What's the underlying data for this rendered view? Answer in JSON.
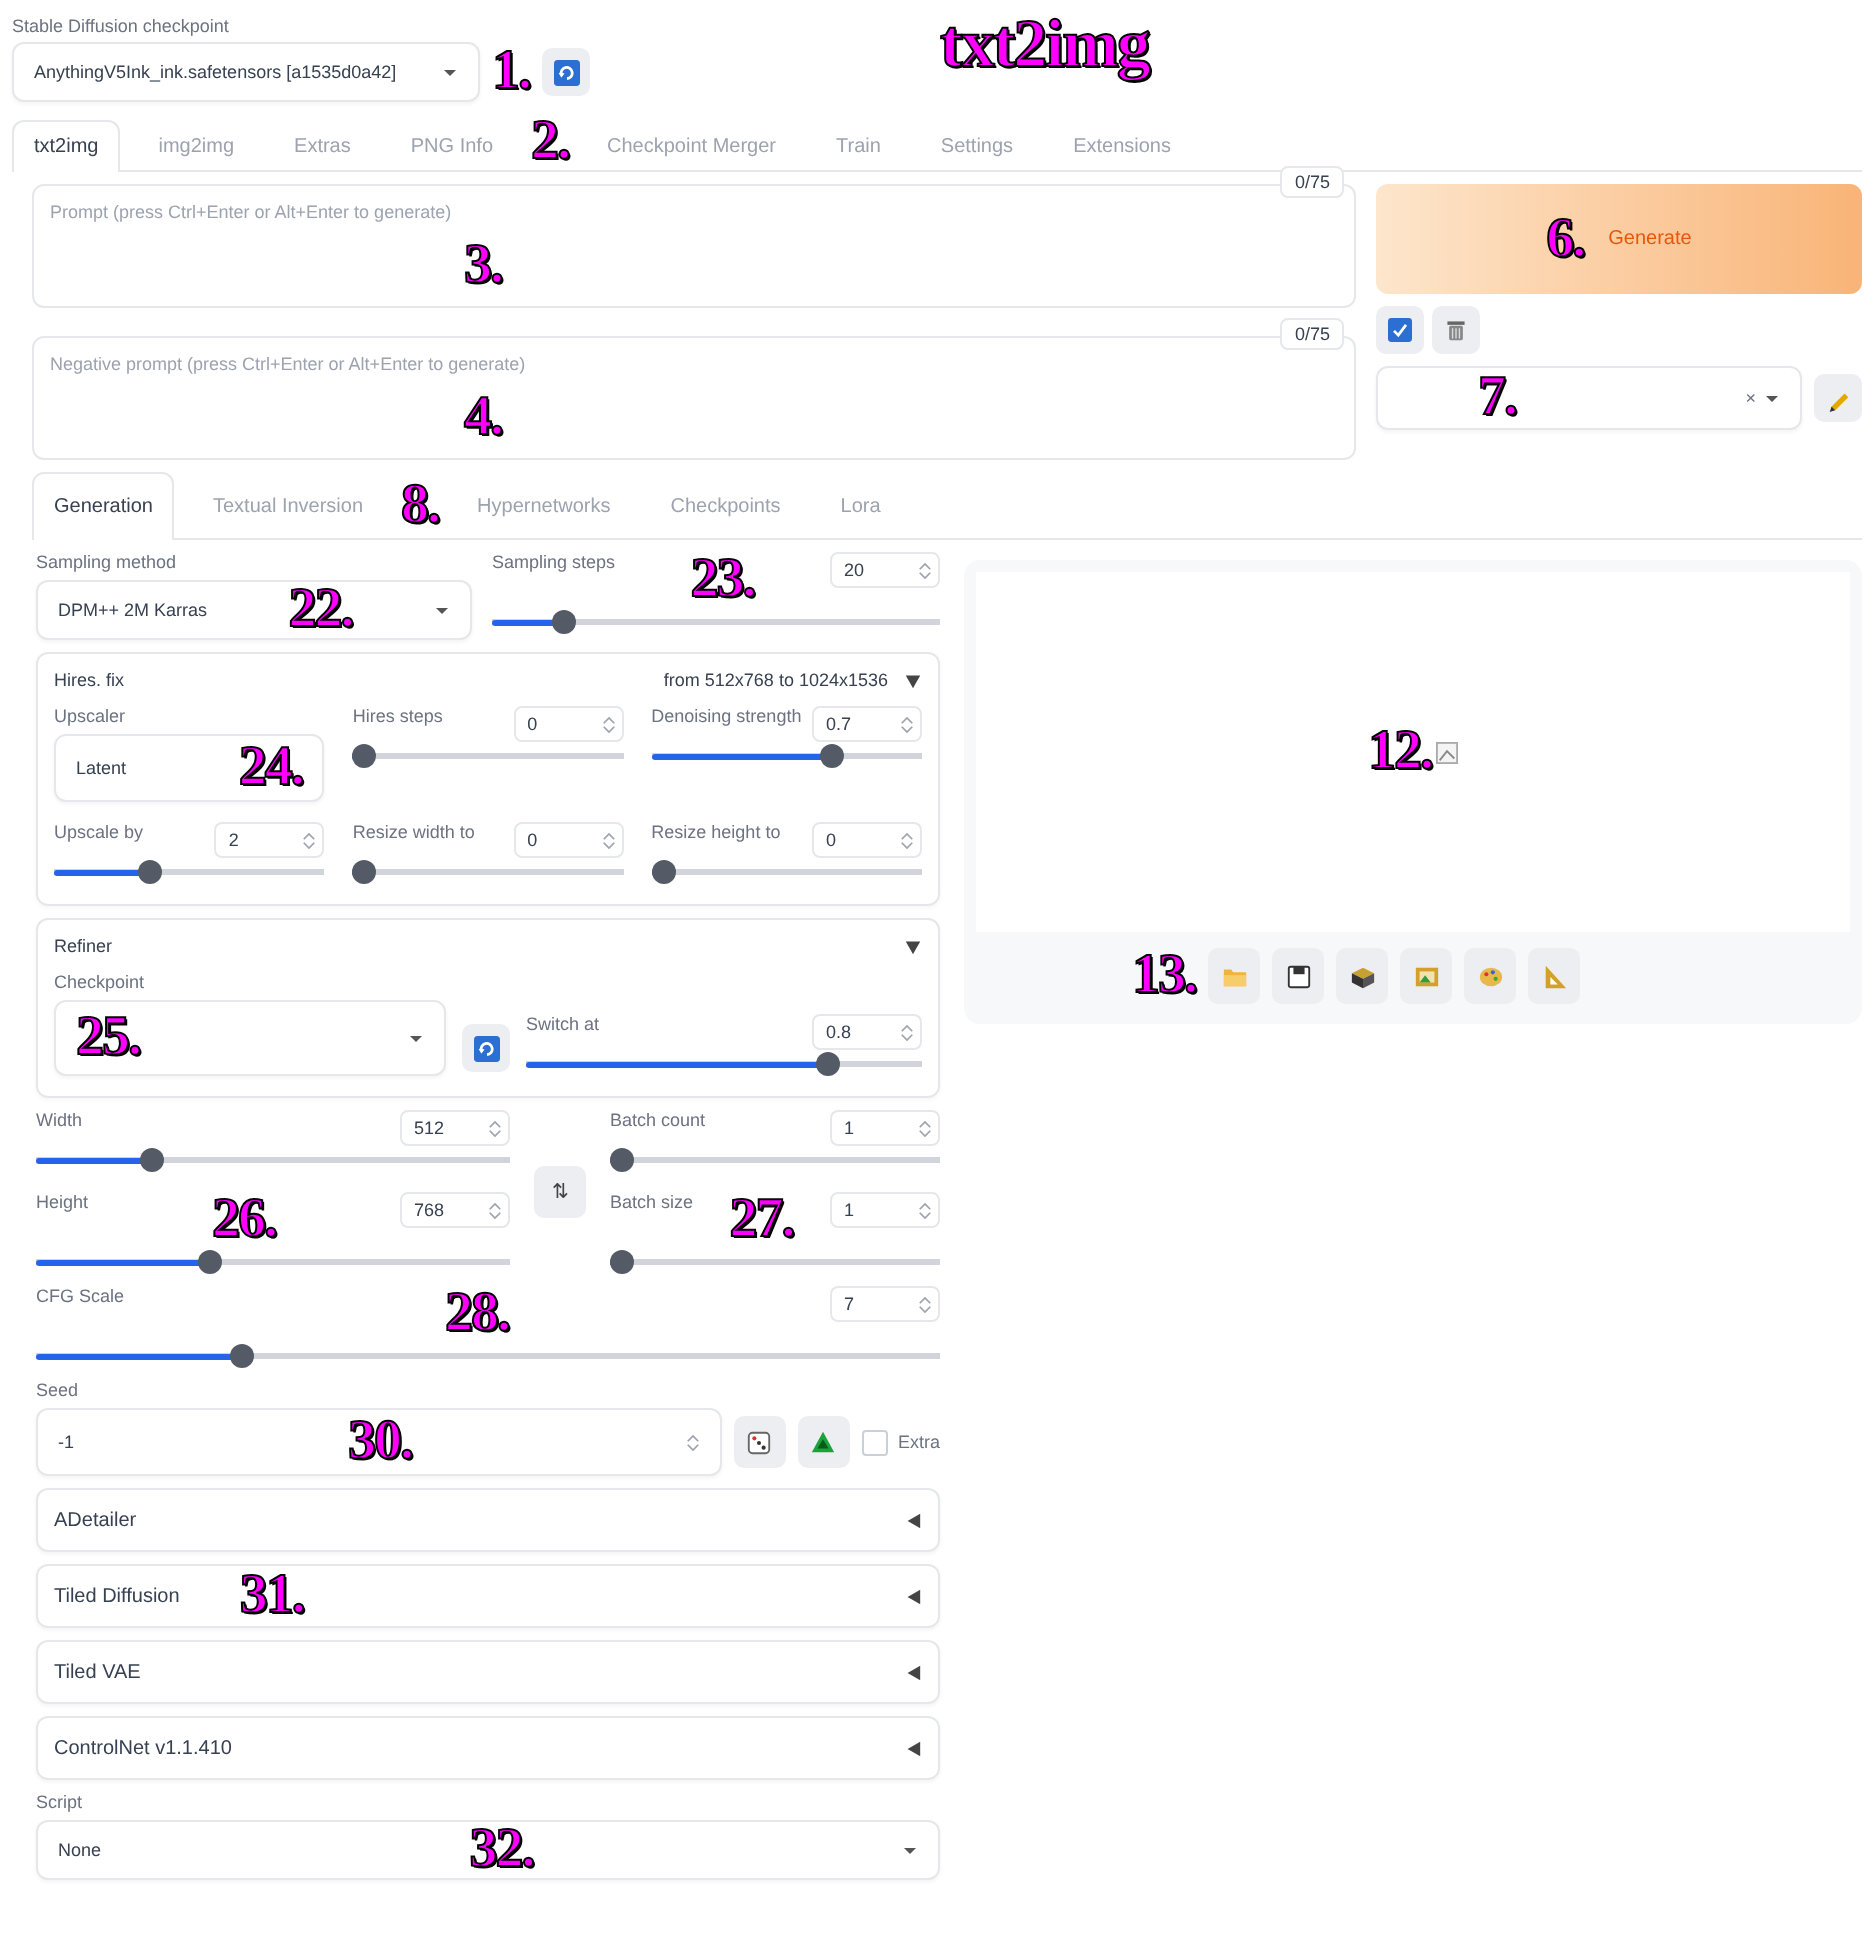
{
  "annotations": [
    {
      "text": "txt2img"
    },
    {
      "text": "1."
    },
    {
      "text": "2."
    },
    {
      "text": "3."
    },
    {
      "text": "4."
    },
    {
      "text": "6."
    },
    {
      "text": "7."
    },
    {
      "text": "8."
    },
    {
      "text": "22."
    },
    {
      "text": "23."
    },
    {
      "text": "24."
    },
    {
      "text": "25."
    },
    {
      "text": "26."
    },
    {
      "text": "27."
    },
    {
      "text": "28."
    },
    {
      "text": "30."
    },
    {
      "text": "31."
    },
    {
      "text": "32."
    },
    {
      "text": "12."
    },
    {
      "text": "13."
    }
  ],
  "checkpoint": {
    "label": "Stable Diffusion checkpoint",
    "value": "AnythingV5Ink_ink.safetensors [a1535d0a42]"
  },
  "tabs": [
    {
      "label": "txt2img",
      "selected": true
    },
    {
      "label": "img2img",
      "selected": false
    },
    {
      "label": "Extras",
      "selected": false
    },
    {
      "label": "PNG Info",
      "selected": false
    },
    {
      "label": "Checkpoint Merger",
      "selected": false
    },
    {
      "label": "Train",
      "selected": false
    },
    {
      "label": "Settings",
      "selected": false
    },
    {
      "label": "Extensions",
      "selected": false
    }
  ],
  "prompt": {
    "placeholder": "Prompt (press Ctrl+Enter or Alt+Enter to generate)",
    "counter": "0/75"
  },
  "negative_prompt": {
    "placeholder": "Negative prompt (press Ctrl+Enter or Alt+Enter to generate)",
    "counter": "0/75"
  },
  "generate": {
    "label": "Generate"
  },
  "styles": {
    "clear": "×"
  },
  "subtabs": [
    {
      "label": "Generation",
      "selected": true
    },
    {
      "label": "Textual Inversion",
      "selected": false
    },
    {
      "label": "Hypernetworks",
      "selected": false
    },
    {
      "label": "Checkpoints",
      "selected": false
    },
    {
      "label": "Lora",
      "selected": false
    }
  ],
  "sampling_method": {
    "label": "Sampling method",
    "value": "DPM++ 2M Karras"
  },
  "sampling_steps": {
    "label": "Sampling steps",
    "value": "20",
    "level": 0.14
  },
  "hires_fix": {
    "title": "Hires. fix",
    "summary": "from 512x768 to 1024x1536",
    "expanded": true,
    "upscaler": {
      "label": "Upscaler",
      "value": "Latent"
    },
    "sliders": [
      {
        "label": "Hires steps",
        "value": "0",
        "level": 0
      },
      {
        "label": "Denoising strength",
        "value": "0.7",
        "level": 0.68
      },
      {
        "label": "Upscale by",
        "value": "2",
        "level": 0.34
      },
      {
        "label": "Resize width to",
        "value": "0",
        "level": 0
      },
      {
        "label": "Resize height to",
        "value": "0",
        "level": 0
      }
    ]
  },
  "refiner": {
    "title": "Refiner",
    "expanded": true,
    "checkpoint": {
      "label": "Checkpoint"
    },
    "switch_at": {
      "label": "Switch at",
      "value": "0.8",
      "level": 0.78
    }
  },
  "size": [
    {
      "label": "Width",
      "value": "512",
      "level": 0.23
    },
    {
      "label": "Height",
      "value": "768",
      "level": 0.36
    }
  ],
  "batch": [
    {
      "label": "Batch count",
      "value": "1",
      "level": 0
    },
    {
      "label": "Batch size",
      "value": "1",
      "level": 0
    }
  ],
  "swap": {
    "glyph": "⇅"
  },
  "cfg_scale": {
    "label": "CFG Scale",
    "value": "7",
    "level": 0.22
  },
  "seed": {
    "label": "Seed",
    "value": "-1"
  },
  "extra": {
    "label": "Extra",
    "checked": false
  },
  "accordions": [
    {
      "title": "ADetailer",
      "expanded": false
    },
    {
      "title": "Tiled Diffusion",
      "expanded": false
    },
    {
      "title": "Tiled VAE",
      "expanded": false
    },
    {
      "title": "ControlNet v1.1.410",
      "expanded": false
    }
  ],
  "script": {
    "label": "Script",
    "value": "None"
  }
}
